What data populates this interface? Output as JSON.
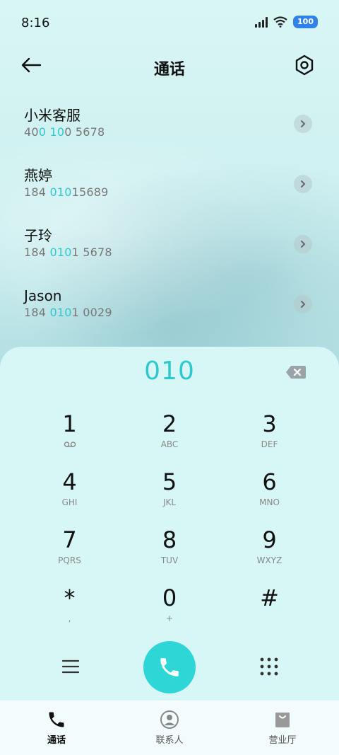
{
  "status": {
    "time": "8:16",
    "battery": "100"
  },
  "header": {
    "title": "通话"
  },
  "contacts": [
    {
      "name": "小米客服",
      "num_pre": "40",
      "num_hl1": "0",
      "num_mid": " ",
      "num_hl2": "10",
      "num_post": "0 5678"
    },
    {
      "name": "燕婷",
      "num_pre": "184 ",
      "num_hl1": "010",
      "num_mid": "",
      "num_hl2": "",
      "num_post": "15689"
    },
    {
      "name": "子玲",
      "num_pre": "184 ",
      "num_hl1": "010",
      "num_mid": "",
      "num_hl2": "",
      "num_post": "1 5678"
    },
    {
      "name": "Jason",
      "num_pre": "184 ",
      "num_hl1": "010",
      "num_mid": "",
      "num_hl2": "",
      "num_post": "1 0029"
    }
  ],
  "dialpad": {
    "number": "010",
    "keys": [
      {
        "digit": "1",
        "letters": ""
      },
      {
        "digit": "2",
        "letters": "ABC"
      },
      {
        "digit": "3",
        "letters": "DEF"
      },
      {
        "digit": "4",
        "letters": "GHI"
      },
      {
        "digit": "5",
        "letters": "JKL"
      },
      {
        "digit": "6",
        "letters": "MNO"
      },
      {
        "digit": "7",
        "letters": "PQRS"
      },
      {
        "digit": "8",
        "letters": "TUV"
      },
      {
        "digit": "9",
        "letters": "WXYZ"
      },
      {
        "digit": "*",
        "letters": ","
      },
      {
        "digit": "0",
        "letters": "+"
      },
      {
        "digit": "#",
        "letters": ""
      }
    ]
  },
  "tabs": [
    {
      "label": "通话",
      "icon": "phone-icon"
    },
    {
      "label": "联系人",
      "icon": "person-icon"
    },
    {
      "label": "营业厅",
      "icon": "bag-icon"
    }
  ],
  "colors": {
    "accent": "#2ec8cf",
    "call": "#2ed6d6",
    "battery": "#2f82e8"
  }
}
